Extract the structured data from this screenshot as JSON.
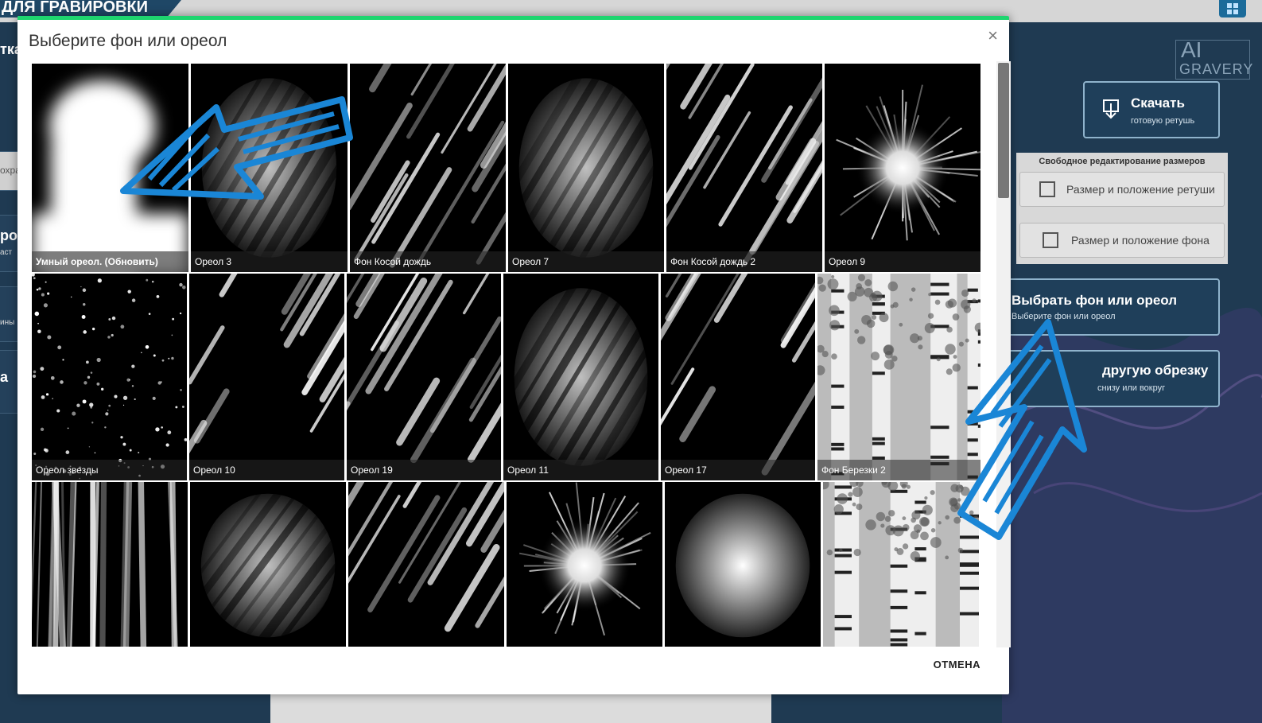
{
  "background_app": {
    "topbar_title": "ДЛЯ ГРАВИРОВКИ",
    "left_fragments": [
      "тка",
      "охра",
      "ро",
      "аст",
      "ины",
      "а"
    ],
    "logo_line1": "AI",
    "logo_line2": "GRAVERY",
    "download_button": {
      "title": "Скачать",
      "subtitle": "готовую ретушь"
    },
    "resize_panel": {
      "header": "Свободное редактирование размеров",
      "retouch_item": "Размер и положение ретуши",
      "background_item": "Размер и положение фона"
    },
    "choose_bg_button": {
      "title": "Выбрать фон или ореол",
      "subtitle": "Выберите фон или ореол"
    },
    "crop_button": {
      "title": "другую обрезку",
      "subtitle": "снизу или вокруг"
    }
  },
  "modal": {
    "title": "Выберите фон или ореол",
    "close_label": "×",
    "cancel_label": "ОТМЕНА",
    "tiles_row1": [
      {
        "label": "Умный ореол. (Обновить)",
        "kind": "silhouette"
      },
      {
        "label": "Ореол 3",
        "kind": "streak-oval"
      },
      {
        "label": "Фон Косой дождь",
        "kind": "rain"
      },
      {
        "label": "Ореол 7",
        "kind": "streak-oval"
      },
      {
        "label": "Фон Косой дождь 2",
        "kind": "rain"
      },
      {
        "label": "Ореол 9",
        "kind": "burst"
      }
    ],
    "tiles_row2": [
      {
        "label": "Ореол звезды",
        "kind": "stars"
      },
      {
        "label": "Ореол 10",
        "kind": "streak-arc"
      },
      {
        "label": "Ореол 19",
        "kind": "rain"
      },
      {
        "label": "Ореол 11",
        "kind": "streak-oval"
      },
      {
        "label": "Ореол 17",
        "kind": "streak-arc"
      },
      {
        "label": "Фон Березки 2",
        "kind": "birch"
      }
    ],
    "tiles_row3": [
      {
        "label": "",
        "kind": "rays"
      },
      {
        "label": "",
        "kind": "streak-oval"
      },
      {
        "label": "",
        "kind": "streak-arc"
      },
      {
        "label": "",
        "kind": "burst"
      },
      {
        "label": "",
        "kind": "glow"
      },
      {
        "label": "",
        "kind": "birch"
      }
    ]
  },
  "colors": {
    "accent_green": "#1ed56f",
    "arrow_blue": "#1a86d6"
  }
}
